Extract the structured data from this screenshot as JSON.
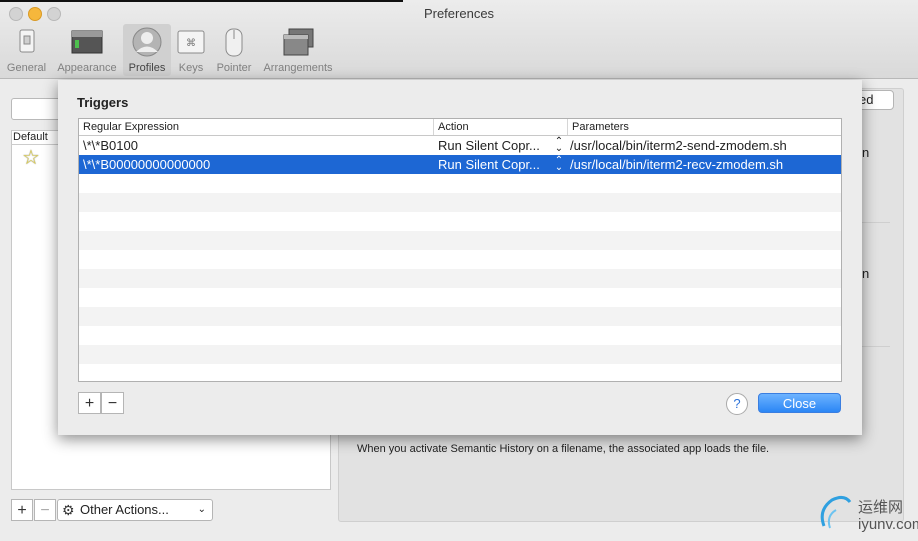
{
  "window": {
    "title": "Preferences"
  },
  "toolbar": {
    "items": [
      {
        "label": "General",
        "icon": "switch-icon"
      },
      {
        "label": "Appearance",
        "icon": "window-icon"
      },
      {
        "label": "Profiles",
        "icon": "profile-icon"
      },
      {
        "label": "Keys",
        "icon": "command-key-icon"
      },
      {
        "label": "Pointer",
        "icon": "mouse-icon"
      },
      {
        "label": "Arrangements",
        "icon": "window-stack-icon"
      }
    ],
    "selected": "Profiles"
  },
  "profiles_list": {
    "column_header": "Default",
    "default_star": "☆"
  },
  "bottom_bar": {
    "add": "+",
    "remove": "−",
    "other_actions_label": "Other Actions...",
    "chevron": "⌄"
  },
  "right_panel": {
    "advanced_fragment": "ed",
    "fragment1": "n",
    "fragment2": "n",
    "semantic_history_text": "When you activate Semantic History on a filename, the associated app loads the file."
  },
  "triggers": {
    "title": "Triggers",
    "columns": [
      "Regular Expression",
      "Action",
      "Parameters"
    ],
    "rows": [
      {
        "regex": "\\*\\*B0100",
        "action": "Run Silent Copr...",
        "params": "/usr/local/bin/iterm2-send-zmodem.sh",
        "selected": false
      },
      {
        "regex": "\\*\\*B00000000000000",
        "action": "Run Silent Copr...",
        "params": "/usr/local/bin/iterm2-recv-zmodem.sh",
        "selected": true
      }
    ],
    "add": "+",
    "remove": "−",
    "help": "?",
    "close_label": "Close"
  },
  "watermark": {
    "cn": "运维网",
    "url": "iyunv.com"
  },
  "colors": {
    "selection": "#1d67d4",
    "close_button": "#2b86f5",
    "star": "#e8d84a"
  }
}
